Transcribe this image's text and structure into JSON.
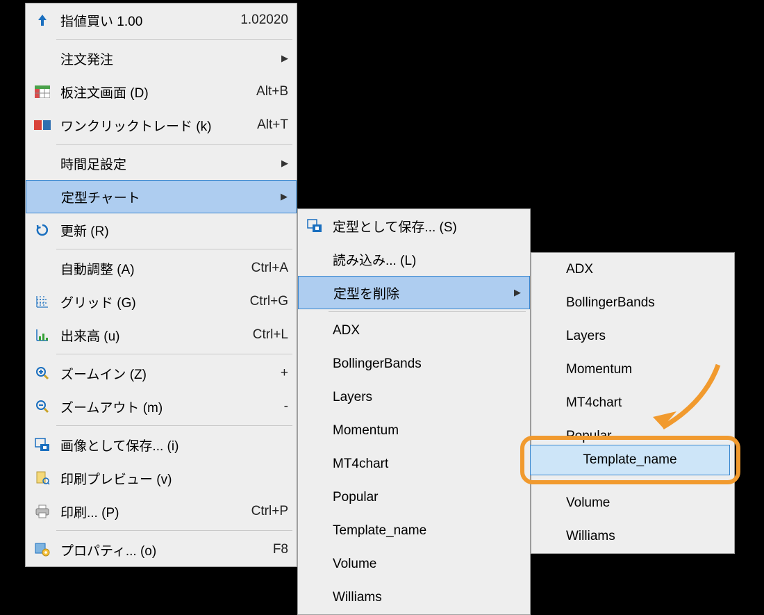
{
  "main_menu": {
    "limit_buy": {
      "label": "指値買い 1.00",
      "value": "1.02020"
    },
    "order": {
      "label": "注文発注"
    },
    "dom": {
      "label": "板注文画面 (D)",
      "accel": "Alt+B"
    },
    "oneclick": {
      "label": "ワンクリックトレード (k)",
      "accel": "Alt+T"
    },
    "timeframe": {
      "label": "時間足設定"
    },
    "template": {
      "label": "定型チャート"
    },
    "refresh": {
      "label": "更新 (R)"
    },
    "autoscale": {
      "label": "自動調整 (A)",
      "accel": "Ctrl+A"
    },
    "grid": {
      "label": "グリッド (G)",
      "accel": "Ctrl+G"
    },
    "volume": {
      "label": "出来高 (u)",
      "accel": "Ctrl+L"
    },
    "zoomin": {
      "label": "ズームイン (Z)",
      "accel": "+"
    },
    "zoomout": {
      "label": "ズームアウト (m)",
      "accel": "-"
    },
    "saveimg": {
      "label": "画像として保存... (i)"
    },
    "printprev": {
      "label": "印刷プレビュー (v)"
    },
    "print": {
      "label": "印刷... (P)",
      "accel": "Ctrl+P"
    },
    "properties": {
      "label": "プロパティ... (o)",
      "accel": "F8"
    }
  },
  "template_menu": {
    "save": {
      "label": "定型として保存... (S)"
    },
    "load": {
      "label": "読み込み... (L)"
    },
    "delete": {
      "label": "定型を削除"
    },
    "items": [
      "ADX",
      "BollingerBands",
      "Layers",
      "Momentum",
      "MT4chart",
      "Popular",
      "Template_name",
      "Volume",
      "Williams"
    ]
  },
  "delete_menu": {
    "items": [
      "ADX",
      "BollingerBands",
      "Layers",
      "Momentum",
      "MT4chart",
      "Popular",
      "Template_name",
      "Volume",
      "Williams"
    ],
    "highlighted": "Template_name"
  }
}
